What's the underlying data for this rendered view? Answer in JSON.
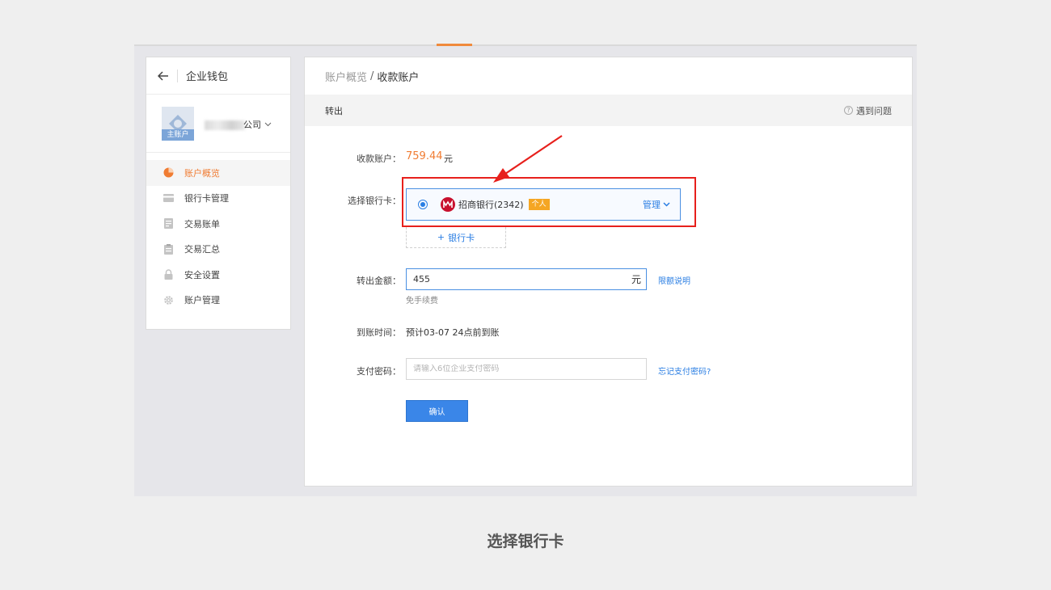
{
  "sidebar": {
    "title": "企业钱包",
    "account_badge": "主账户",
    "company_suffix": "公司",
    "items": [
      {
        "label": "账户概览",
        "icon": "pie-chart-icon",
        "active": true
      },
      {
        "label": "银行卡管理",
        "icon": "card-icon",
        "active": false
      },
      {
        "label": "交易账单",
        "icon": "document-icon",
        "active": false
      },
      {
        "label": "交易汇总",
        "icon": "clipboard-icon",
        "active": false
      },
      {
        "label": "安全设置",
        "icon": "lock-icon",
        "active": false
      },
      {
        "label": "账户管理",
        "icon": "gear-icon",
        "active": false
      }
    ]
  },
  "breadcrumb": {
    "parent": "账户概览",
    "separator": "/",
    "current": "收款账户"
  },
  "section": {
    "title": "转出",
    "help": "遇到问题"
  },
  "form": {
    "balance_label": "收款账户：",
    "balance_value": "759.44",
    "balance_unit": "元",
    "card_label": "选择银行卡：",
    "bank_name": "招商银行(2342)",
    "bank_tag": "个人",
    "manage": "管理",
    "add_card": "银行卡",
    "amount_label": "转出金额：",
    "amount_value": "455",
    "amount_unit": "元",
    "limit_link": "限额说明",
    "fee_hint": "免手续费",
    "arrival_label": "到账时间：",
    "arrival_value": "预计03-07 24点前到账",
    "password_label": "支付密码：",
    "password_placeholder": "请输入6位企业支付密码",
    "forgot_link": "忘记支付密码?",
    "confirm": "确认"
  },
  "caption": "选择银行卡",
  "colors": {
    "accent_orange": "#f07c32",
    "primary_blue": "#3a86e8",
    "highlight_red": "#e7201c",
    "bank_red": "#c8102e",
    "tag_orange": "#f5a623"
  }
}
